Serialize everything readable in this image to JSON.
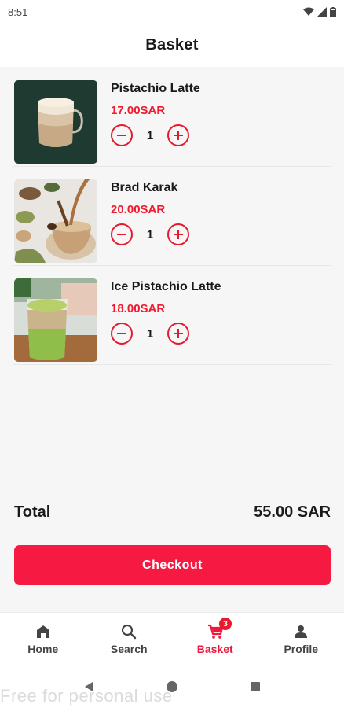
{
  "status_bar": {
    "time": "8:51"
  },
  "header": {
    "title": "Basket"
  },
  "items": [
    {
      "name": "Pistachio Latte",
      "price": "17.00SAR",
      "quantity": "1",
      "image": "pistachio-latte-image"
    },
    {
      "name": "Brad Karak",
      "price": "20.00SAR",
      "quantity": "1",
      "image": "karak-tea-image"
    },
    {
      "name": "Ice Pistachio Latte",
      "price": "18.00SAR",
      "quantity": "1",
      "image": "iced-pistachio-latte-image"
    }
  ],
  "summary": {
    "total_label": "Total",
    "total_value": "55.00 SAR"
  },
  "checkout": {
    "label": "Checkout"
  },
  "bottom_nav": {
    "items": [
      {
        "label": "Home",
        "icon": "home-icon",
        "active": false
      },
      {
        "label": "Search",
        "icon": "search-icon",
        "active": false
      },
      {
        "label": "Basket",
        "icon": "cart-icon",
        "active": true,
        "badge": "3"
      },
      {
        "label": "Profile",
        "icon": "person-icon",
        "active": false
      }
    ]
  },
  "watermark": "Free for personal use",
  "colors": {
    "accent": "#f61a43",
    "price": "#f0192f",
    "text": "#1a1a1a",
    "background": "#f6f6f6"
  }
}
